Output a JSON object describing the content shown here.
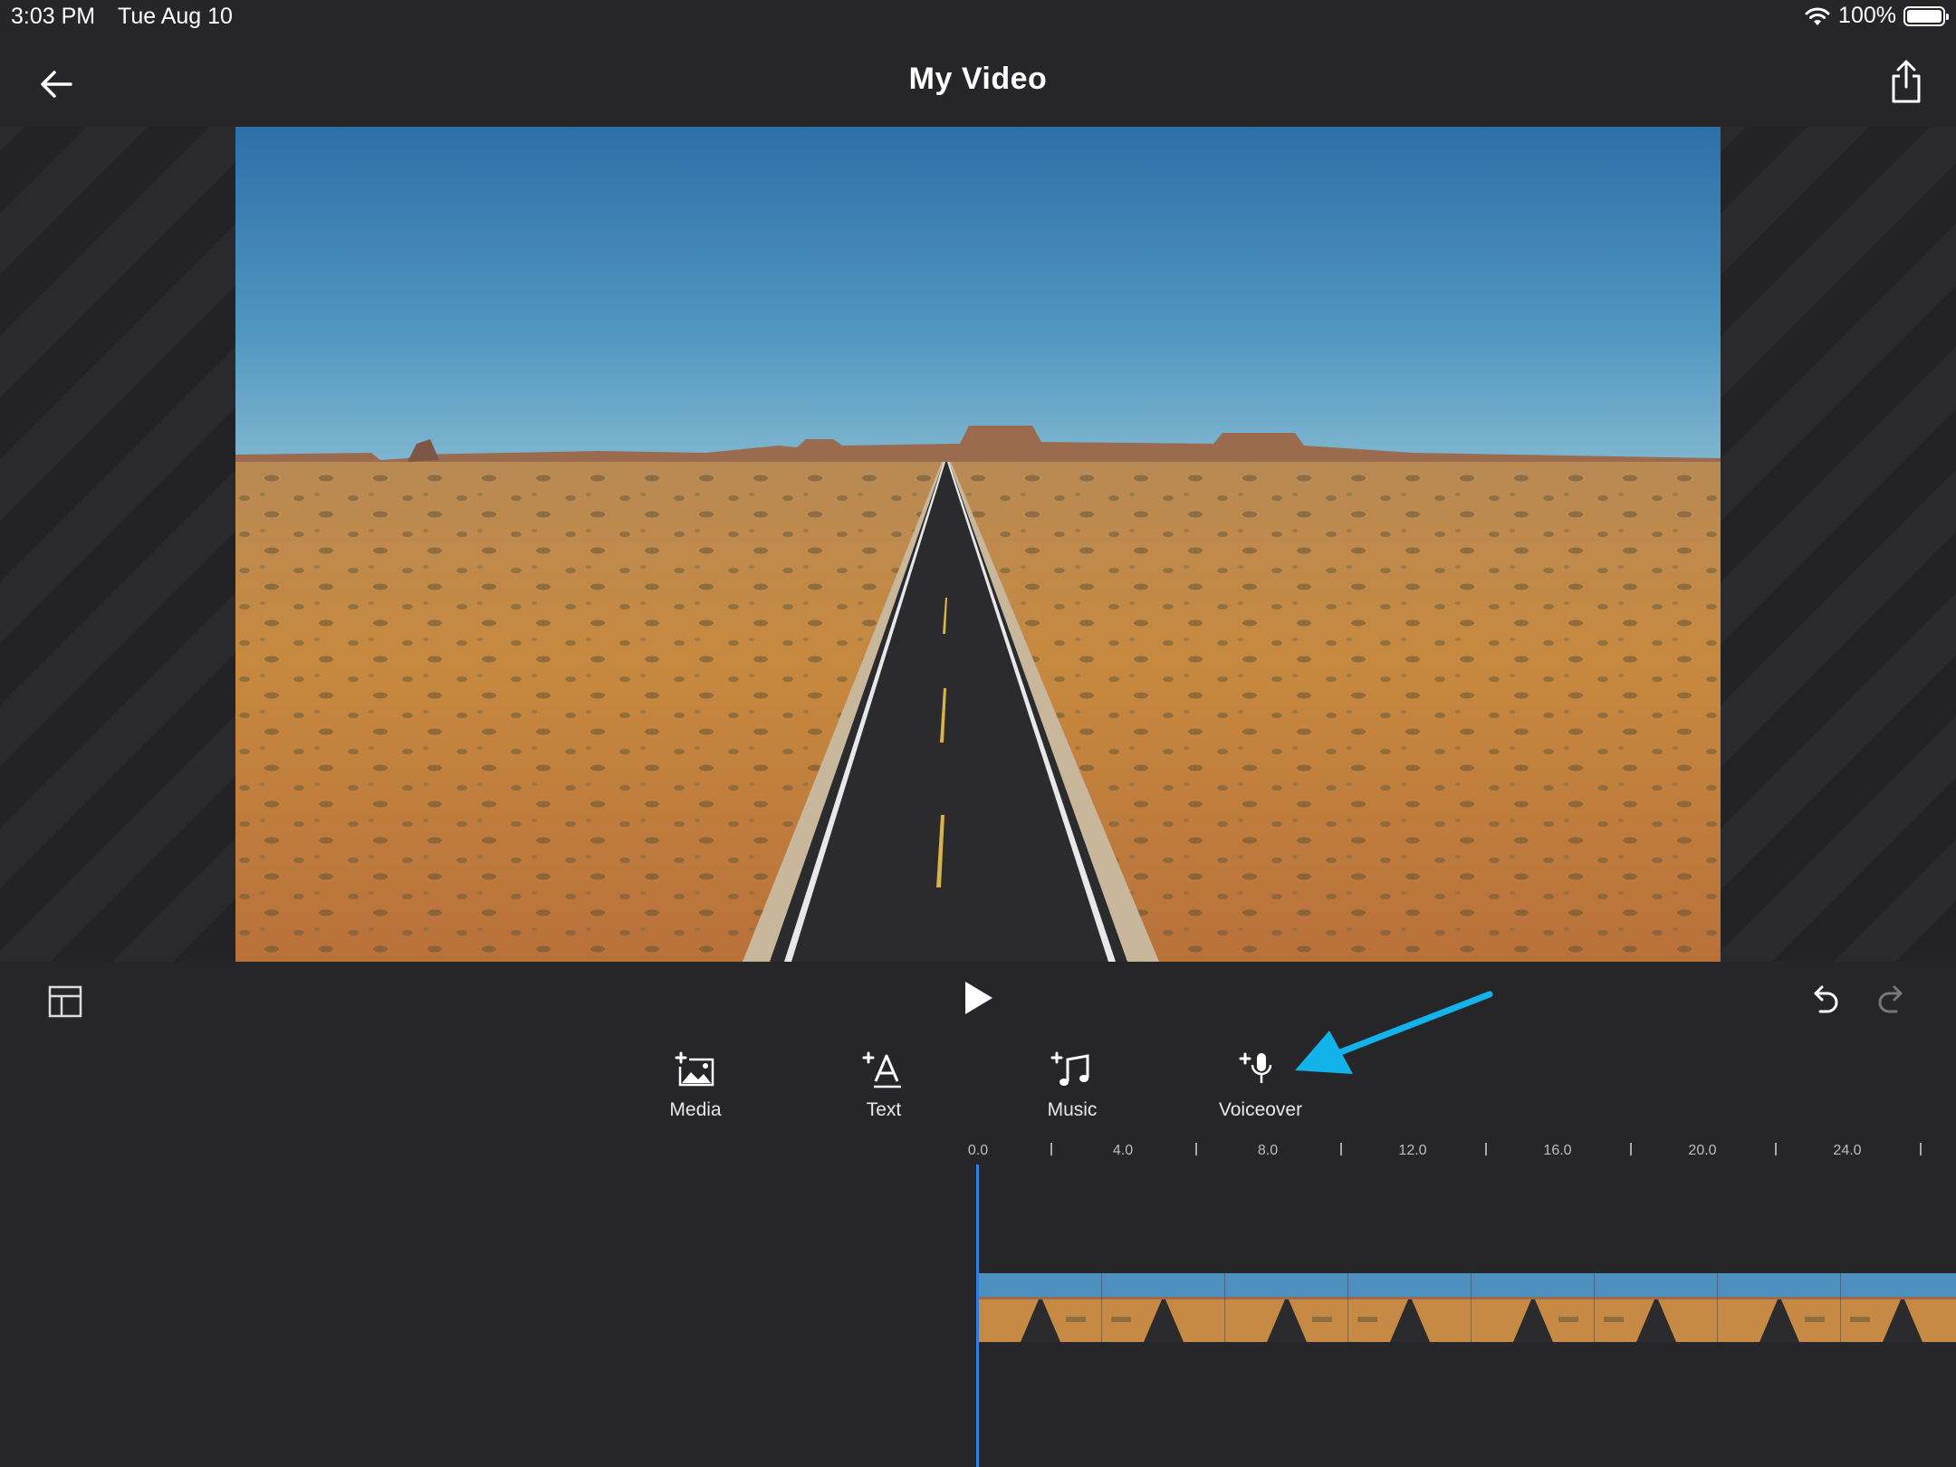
{
  "status": {
    "time": "3:03 PM",
    "date": "Tue Aug 10",
    "battery": "100%",
    "battery_level": 1.0
  },
  "header": {
    "title": "My Video",
    "back_icon": "arrow-left-icon",
    "share_icon": "share-icon"
  },
  "preview": {
    "description_icon": "video-frame"
  },
  "controls": {
    "layout_icon": "layout-icon",
    "play_icon": "play-icon",
    "undo_icon": "undo-icon",
    "redo_icon": "redo-icon"
  },
  "tools": [
    {
      "label": "Media",
      "icon": "add-media-icon"
    },
    {
      "label": "Text",
      "icon": "add-text-icon"
    },
    {
      "label": "Music",
      "icon": "add-music-icon"
    },
    {
      "label": "Voiceover",
      "icon": "add-voiceover-icon"
    }
  ],
  "timeline": {
    "ruler_labels": [
      "0.0",
      "4.0",
      "8.0",
      "12.0",
      "16.0",
      "20.0",
      "24.0"
    ],
    "thumbnail_count": 8
  },
  "colors": {
    "accent": "#2f7fe0",
    "annotation_arrow": "#12b3ea",
    "background": "#262628"
  }
}
